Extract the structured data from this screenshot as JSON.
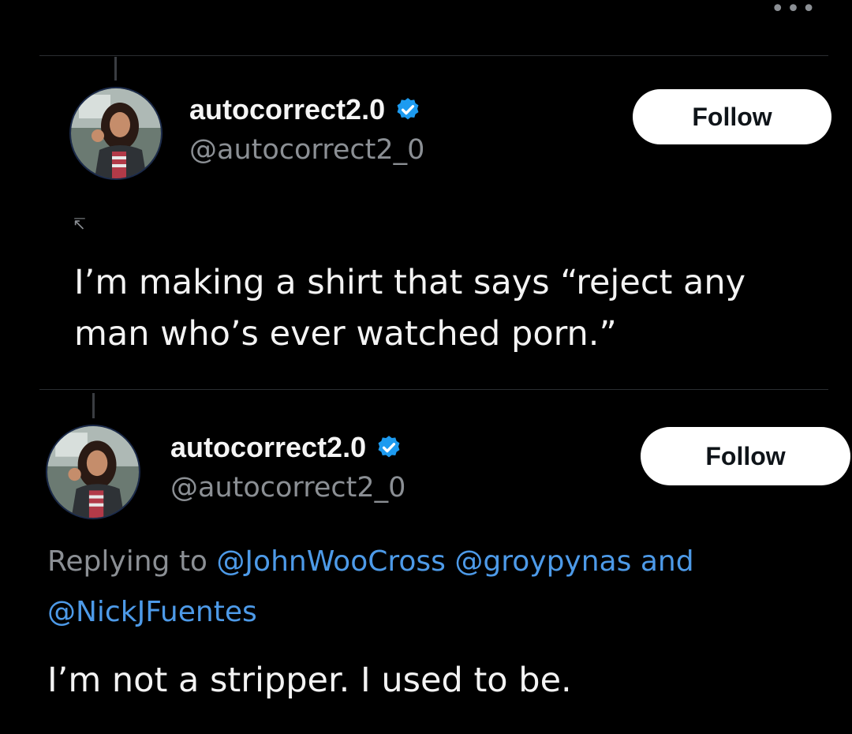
{
  "menu": {
    "more_icon": "more-horizontal-icon",
    "glyph": "•••"
  },
  "tweets": [
    {
      "display_name": "autocorrect2.0",
      "handle": "@autocorrect2_0",
      "verified_icon": "verified-badge-icon",
      "follow_label": "Follow",
      "text_lines": [
        "I’m making a shirt that says “reject any",
        "man who’s ever watched porn.”"
      ]
    },
    {
      "display_name": "autocorrect2.0",
      "handle": "@autocorrect2_0",
      "verified_icon": "verified-badge-icon",
      "follow_label": "Follow",
      "replying_to": {
        "prefix": "Replying to",
        "mentions": [
          "@JohnWooCross",
          "@groypynas",
          "@NickJFuentes"
        ],
        "joiner": "and"
      },
      "text": "I’m not a stripper. I used to be."
    }
  ],
  "colors": {
    "background": "#000000",
    "secondary_text": "#8b8f94",
    "mention": "#4d9ae8",
    "verified": "#1d9bf0",
    "follow_button_bg": "#ffffff"
  }
}
